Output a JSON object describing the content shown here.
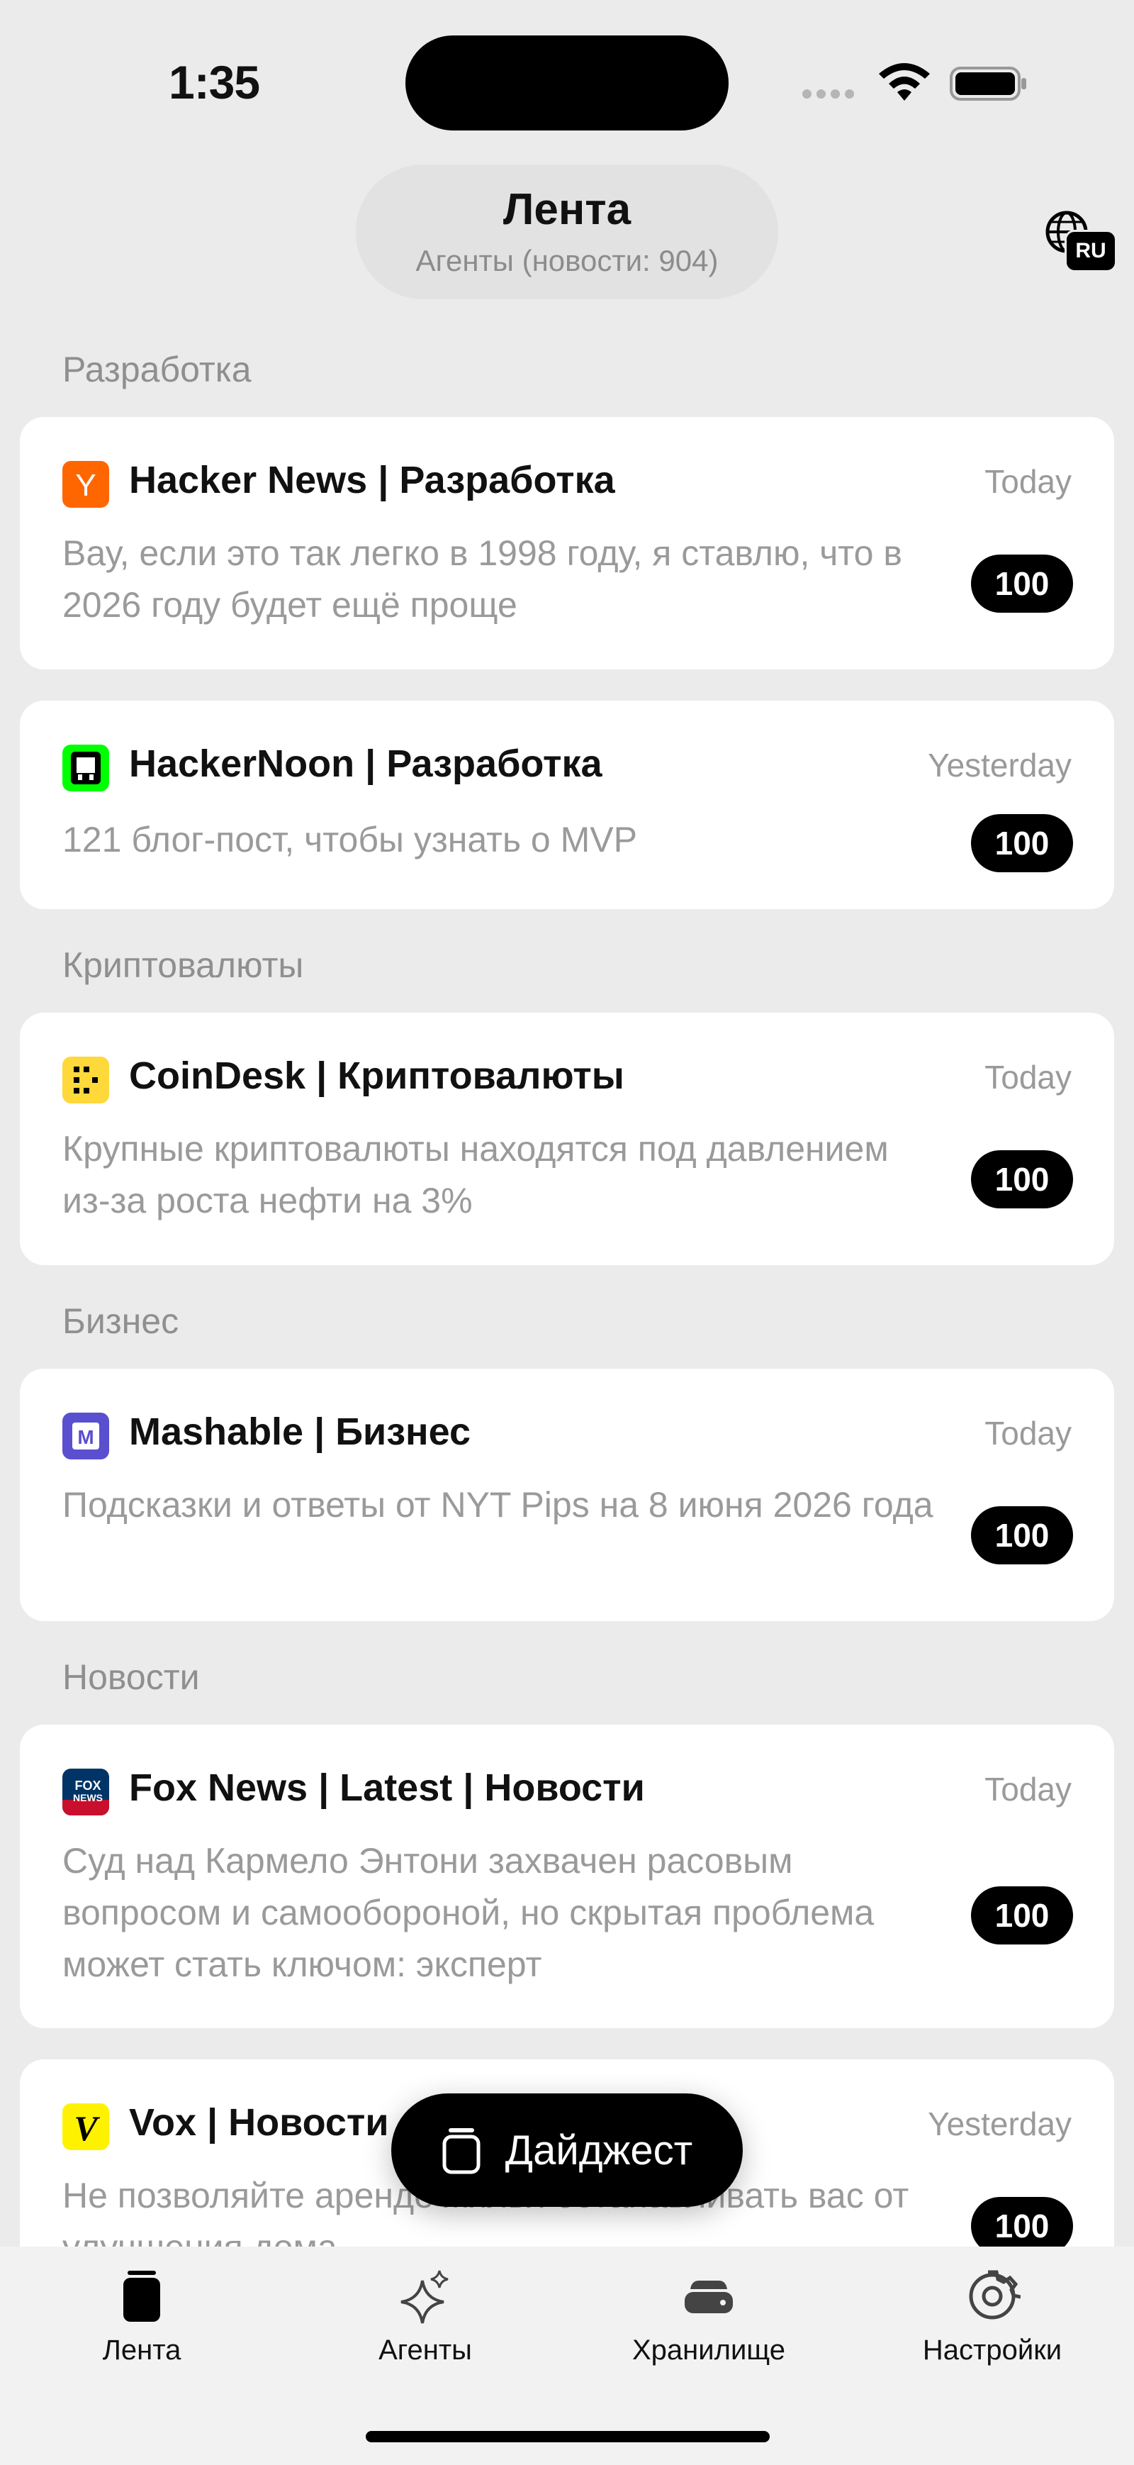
{
  "status_bar": {
    "time": "1:35"
  },
  "header": {
    "title": "Лента",
    "subtitle": "Агенты (новости: 904)",
    "language_badge": "RU"
  },
  "sections": [
    {
      "title": "Разработка"
    },
    {
      "title": "Криптовалюты"
    },
    {
      "title": "Бизнес"
    },
    {
      "title": "Новости"
    }
  ],
  "cards": [
    {
      "logo": "hacker-news-logo",
      "logo_color": "#ff6600",
      "title": "Hacker News | Разработка",
      "date": "Today",
      "body": "Вау, если это так легко в 1998 году, я ставлю, что в 2026 году будет ещё проще",
      "score": "100"
    },
    {
      "logo": "hackernoon-logo",
      "logo_color": "#00ff00",
      "title": "HackerNoon | Разработка",
      "date": "Yesterday",
      "body": "121 блог-пост, чтобы узнать о MVP",
      "score": "100"
    },
    {
      "logo": "coindesk-logo",
      "logo_color": "#ffd83a",
      "title": "CoinDesk | Криптовалюты",
      "date": "Today",
      "body": "Крупные криптовалюты находятся под давлением из-за роста нефти на 3%",
      "score": "100"
    },
    {
      "logo": "mashable-logo",
      "logo_color": "#5a4fcf",
      "title": "Mashable | Бизнес",
      "date": "Today",
      "body": "Подсказки и ответы от NYT Pips на 8 июня 2026 года",
      "score": "100"
    },
    {
      "logo": "fox-news-logo",
      "logo_color": "#003366",
      "title": "Fox News | Latest | Новости",
      "date": "Today",
      "body": "Суд над Кармело Энтони захвачен расовым вопросом и самообороной, но скрытая проблема может стать ключом: эксперт",
      "score": "100"
    },
    {
      "logo": "vox-logo",
      "logo_color": "#fff200",
      "title": "Vox | Новости",
      "date": "Yesterday",
      "body": "Не позволяйте аренде жилья останавливать вас от улучшения дома",
      "score": "100"
    }
  ],
  "digest_button": {
    "label": "Дайджест"
  },
  "tabbar": {
    "items": [
      {
        "label": "Лента",
        "icon": "feed-icon",
        "active": true
      },
      {
        "label": "Агенты",
        "icon": "sparkles-icon",
        "active": false
      },
      {
        "label": "Хранилище",
        "icon": "storage-icon",
        "active": false
      },
      {
        "label": "Настройки",
        "icon": "gear-icon",
        "active": false
      }
    ]
  }
}
